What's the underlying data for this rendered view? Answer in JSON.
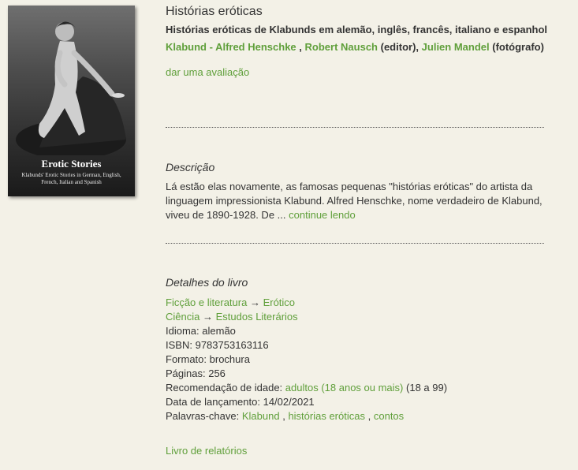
{
  "book": {
    "cover": {
      "title": "Erotic Stories",
      "subtitle": "Klabunds' Erotic Stories in German, English, French, Italian and Spanish"
    },
    "title": "Histórias eróticas",
    "subtitle": "Histórias eróticas de Klabunds em alemão, inglês, francês, italiano e espanhol",
    "authors": [
      {
        "name": "Klabund - Alfred Henschke",
        "role": ""
      },
      {
        "name": "Robert Nausch",
        "role": "(editor)"
      },
      {
        "name": "Julien Mandel",
        "role": "(fotógrafo)"
      }
    ],
    "sep_comma": ",",
    "rate_link": "dar uma avaliação"
  },
  "description": {
    "heading": "Descrição",
    "text": "Lá estão elas novamente, as famosas pequenas \"histórias eróticas\" do artista da linguagem impressionista Klabund. Alfred Henschke, nome verdadeiro de Klabund, viveu de 1890-1928. De ...",
    "more_link": "continue lendo"
  },
  "details": {
    "heading": "Detalhes do livro",
    "arrow": "→",
    "categories": [
      {
        "parent": "Ficção e literatura",
        "child": "Erótico"
      },
      {
        "parent": "Ciência",
        "child": "Estudos Literários"
      }
    ],
    "language_label": "Idioma:",
    "language": "alemão",
    "isbn_label": "ISBN:",
    "isbn": "9783753163116",
    "format_label": "Formato:",
    "format": "brochura",
    "pages_label": "Páginas:",
    "pages": "256",
    "age_label": "Recomendação de idade:",
    "age_link": "adultos (18 anos ou mais)",
    "age_range": "(18 a 99)",
    "release_label": "Data de lançamento:",
    "release": "14/02/2021",
    "keywords_label": "Palavras-chave:",
    "keywords": [
      "Klabund",
      "histórias eróticas",
      "contos"
    ]
  },
  "report_link": "Livro de relatórios"
}
